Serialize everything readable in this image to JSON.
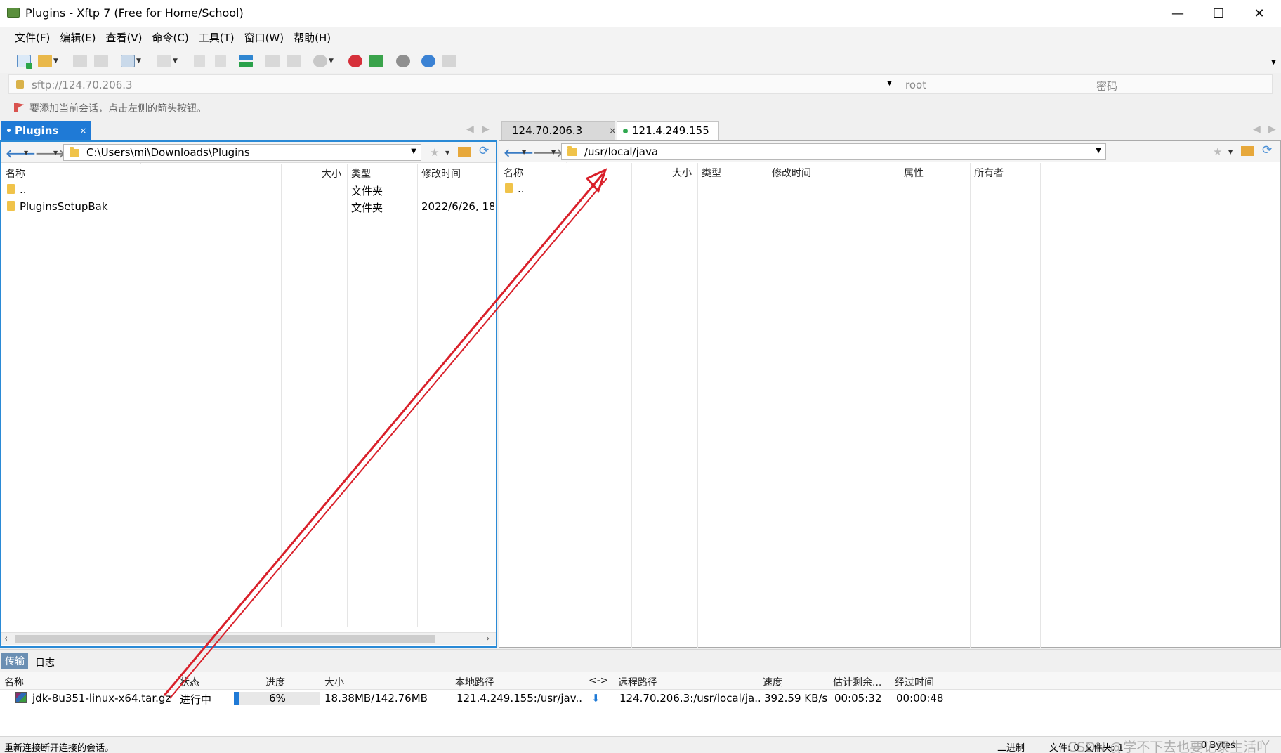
{
  "window": {
    "title": "Plugins - Xftp 7 (Free for Home/School)",
    "minimize": "—",
    "maximize": "☐",
    "close": "✕"
  },
  "menu": [
    "文件(F)",
    "编辑(E)",
    "查看(V)",
    "命令(C)",
    "工具(T)",
    "窗口(W)",
    "帮助(H)"
  ],
  "address": {
    "url": "sftp://124.70.206.3",
    "username": "root",
    "password_placeholder": "密码"
  },
  "hint": "要添加当前会话，点击左侧的箭头按钮。",
  "local": {
    "tab_label": "Plugins",
    "tab_close": "×",
    "path": "C:\\Users\\mi\\Downloads\\Plugins",
    "columns": [
      "名称",
      "大小",
      "类型",
      "修改时间"
    ],
    "rows": [
      {
        "name": "..",
        "size": "",
        "type": "文件夹",
        "modified": ""
      },
      {
        "name": "PluginsSetupBak",
        "size": "",
        "type": "文件夹",
        "modified": "2022/6/26, 18:"
      }
    ]
  },
  "remote": {
    "tabs": [
      {
        "label": "124.70.206.3",
        "close": "×",
        "status_color": "#2fa84f"
      },
      {
        "label": "121.4.249.155",
        "close": "",
        "status_color": "#2fa84f"
      }
    ],
    "path": "/usr/local/java",
    "columns": [
      "名称",
      "大小",
      "类型",
      "修改时间",
      "属性",
      "所有者"
    ],
    "rows": [
      {
        "name": ".."
      }
    ]
  },
  "transfer": {
    "tabs": [
      "传输",
      "日志"
    ],
    "columns": [
      "名称",
      "状态",
      "进度",
      "大小",
      "本地路径",
      "<->",
      "远程路径",
      "速度",
      "估计剩余...",
      "经过时间"
    ],
    "item": {
      "name": "jdk-8u351-linux-x64.tar.gz",
      "status": "进行中",
      "progress_text": "6%",
      "progress_fraction": 0.06,
      "size": "18.38MB/142.76MB",
      "local_path": "121.4.249.155:/usr/jav..",
      "direction": "⬇",
      "remote_path": "124.70.206.3:/usr/local/ja...",
      "speed": "392.59 KB/s",
      "eta": "00:05:32",
      "elapsed": "00:00:48"
    }
  },
  "statusbar": {
    "message": "重新连接断开连接的会话。",
    "mode": "二进制",
    "files": "文件: 0",
    "folders": "文件夹: 1",
    "bytes": "0 Bytes",
    "watermark": "CSDN @学不下去也要记录生活吖"
  },
  "colors": {
    "accent": "#1f7ad6",
    "annotation_arrow": "#d9202a"
  }
}
